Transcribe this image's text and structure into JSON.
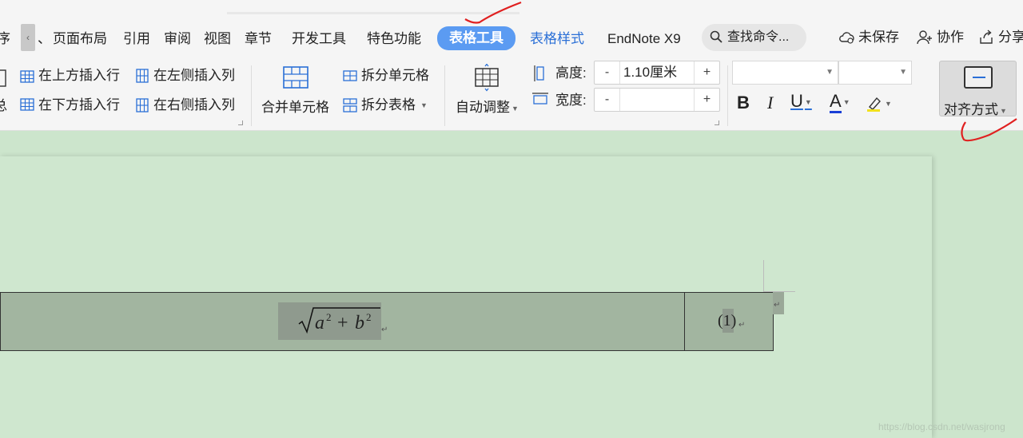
{
  "tabs": [
    {
      "label": "页面布局"
    },
    {
      "label": "引用"
    },
    {
      "label": "审阅"
    },
    {
      "label": "视图"
    },
    {
      "label": "章节"
    },
    {
      "label": "开发工具"
    },
    {
      "label": "特色功能"
    },
    {
      "label": "表格工具"
    },
    {
      "label": "表格样式"
    },
    {
      "label": "EndNote X9"
    }
  ],
  "tab_prefix": "、",
  "left_edge_char": "序",
  "left_edge_char2": "总",
  "search": {
    "placeholder": "查找命令..."
  },
  "right": {
    "unsaved": "未保存",
    "collab": "协作",
    "share": "分享"
  },
  "ribbon": {
    "insert_above": "在上方插入行",
    "insert_below": "在下方插入行",
    "insert_left": "在左侧插入列",
    "insert_right": "在右侧插入列",
    "merge_cells": "合并单元格",
    "split_cells": "拆分单元格",
    "split_table": "拆分表格",
    "auto_adjust": "自动调整",
    "height_label": "高度:",
    "height_value": "1.10厘米",
    "width_label": "宽度:",
    "width_value": "",
    "stepper_minus": "-",
    "stepper_plus": "+",
    "bold": "B",
    "italic": "I",
    "underline": "U",
    "font_color": "A",
    "align": "对齐方式"
  },
  "document": {
    "formula_a": "a",
    "formula_b": "b",
    "formula_exp": "2",
    "formula_plus": "+",
    "equation_number": "(1)",
    "paragraph_mark": "↵"
  },
  "watermark": "https://blog.csdn.net/wasjrong",
  "colors": {
    "active_tab": "#5b9bf2",
    "accent_blue": "#2a6fd6",
    "page_bg": "#cfe7cf",
    "annotation_red": "#e02020"
  }
}
